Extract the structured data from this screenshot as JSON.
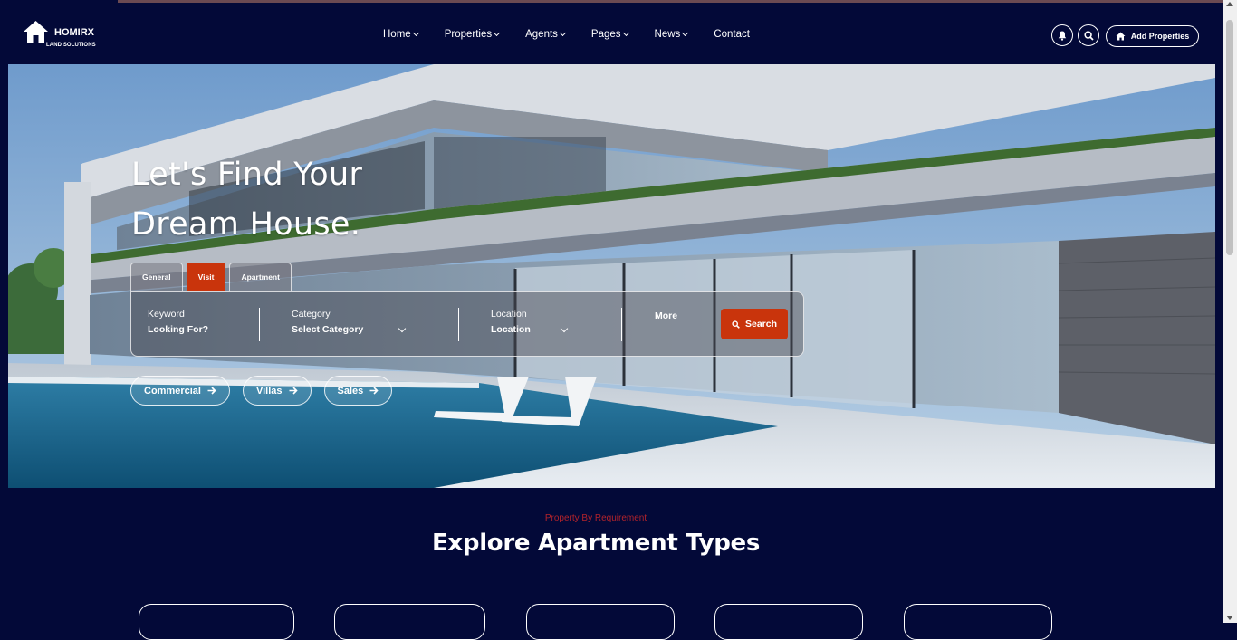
{
  "brand": {
    "name": "HOMIRX",
    "tagline": "LAND SOLUTIONS"
  },
  "nav": {
    "items": [
      {
        "label": "Home",
        "dropdown": true
      },
      {
        "label": "Properties",
        "dropdown": true
      },
      {
        "label": "Agents",
        "dropdown": true
      },
      {
        "label": "Pages",
        "dropdown": true
      },
      {
        "label": "News",
        "dropdown": true
      },
      {
        "label": "Contact",
        "dropdown": false
      }
    ]
  },
  "header_actions": {
    "notification_icon": "bell-icon",
    "search_icon": "search-icon",
    "add_label": "Add Properties"
  },
  "hero": {
    "title_line1": "Let's Find Your",
    "title_line2": "Dream House.",
    "tabs": [
      {
        "label": "General",
        "active": false
      },
      {
        "label": "Visit",
        "active": true
      },
      {
        "label": "Apartment",
        "active": false
      }
    ],
    "search": {
      "keyword_label": "Keyword",
      "keyword_value": "Looking For?",
      "category_label": "Category",
      "category_value": "Select Category",
      "location_label": "Location",
      "location_value": "Location",
      "more_label": "More",
      "search_label": "Search"
    },
    "chips": [
      {
        "label": "Commercial"
      },
      {
        "label": "Villas"
      },
      {
        "label": "Sales"
      }
    ]
  },
  "explore": {
    "eyebrow": "Property By Requirement",
    "heading": "Explore Apartment Types"
  },
  "colors": {
    "background": "#030938",
    "accent": "#c9340c",
    "eyebrow": "#b3232b"
  }
}
